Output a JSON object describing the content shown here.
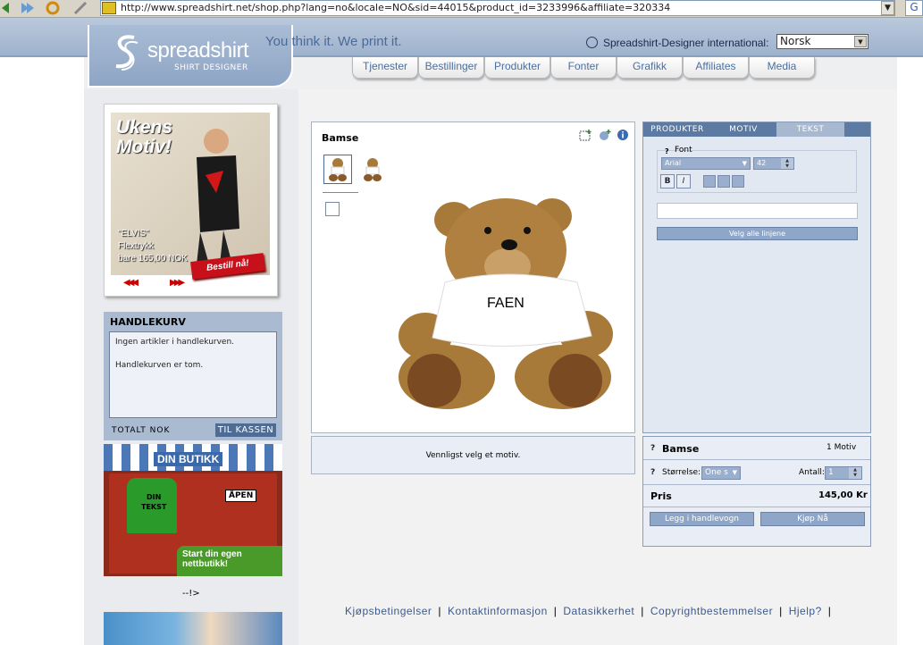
{
  "browser": {
    "url": "http://www.spreadshirt.net/shop.php?lang=no&locale=NO&sid=44015&product_id=3233996&affiliate=320334",
    "go_label": "G"
  },
  "header": {
    "logo_text": "spreadshirt",
    "logo_sub": "SHIRT DESIGNER",
    "tagline": "You think it. We print it.",
    "intl_label": "Spreadshirt-Designer international:",
    "language": "Norsk",
    "brand_color": "#9eb2cd"
  },
  "nav": [
    "Tjenester",
    "Bestillinger",
    "Produkter",
    "Fonter",
    "Grafikk",
    "Affiliates",
    "Media"
  ],
  "promo": {
    "title_line1": "Ukens",
    "title_line2": "Motiv!",
    "line1": "\"ELVIS\"",
    "line2": "Flextrykk",
    "line3": "bare 165,00 NOK",
    "button": "Bestill nå!",
    "prev": "◀◀◀",
    "next": "▶▶▶"
  },
  "cart": {
    "title": "HANDLEKURV",
    "msg1": "Ingen artikler i handlekurven.",
    "msg2": "Handlekurven er tom.",
    "total_label": "TOTALT  NOK",
    "checkout": "TIL KASSEN"
  },
  "shop_banner": {
    "title": "DIN BUTIKK",
    "shirt_text_1": "DIN",
    "shirt_text_2": "TEKST",
    "open_sign": "ÅPEN",
    "cta_line1": "Start din egen",
    "cta_line2": "nettbutikk!"
  },
  "left_marker": "--!>",
  "product": {
    "name": "Bamse",
    "shirt_text": "FAEN",
    "message": "Vennligst velg et motiv."
  },
  "designer": {
    "tabs": [
      "PRODUKTER",
      "MOTIV",
      "TEKST"
    ],
    "active_tab": "TEKST",
    "font_q": "?",
    "font_label": "Font",
    "font_value": "Arial",
    "size_value": "42",
    "bold": "B",
    "italic": "I",
    "text_value": "",
    "select_lines": "Velg alle linjene"
  },
  "order": {
    "q": "?",
    "name": "Bamse",
    "motiv_count": "1 Motiv",
    "size_label": "Størrelse:",
    "size_value": "One s",
    "qty_label": "Antall:",
    "qty_value": "1",
    "price_label": "Pris",
    "price": "145,00 Kr",
    "add_cart": "Legg i handlevogn",
    "buy_now": "Kjøp Nå"
  },
  "footer": {
    "links": [
      "Kjøpsbetingelser",
      "Kontaktinformasjon",
      "Datasikkerhet",
      "Copyrightbestemmelser",
      "Hjelp?"
    ],
    "sep": "|"
  }
}
